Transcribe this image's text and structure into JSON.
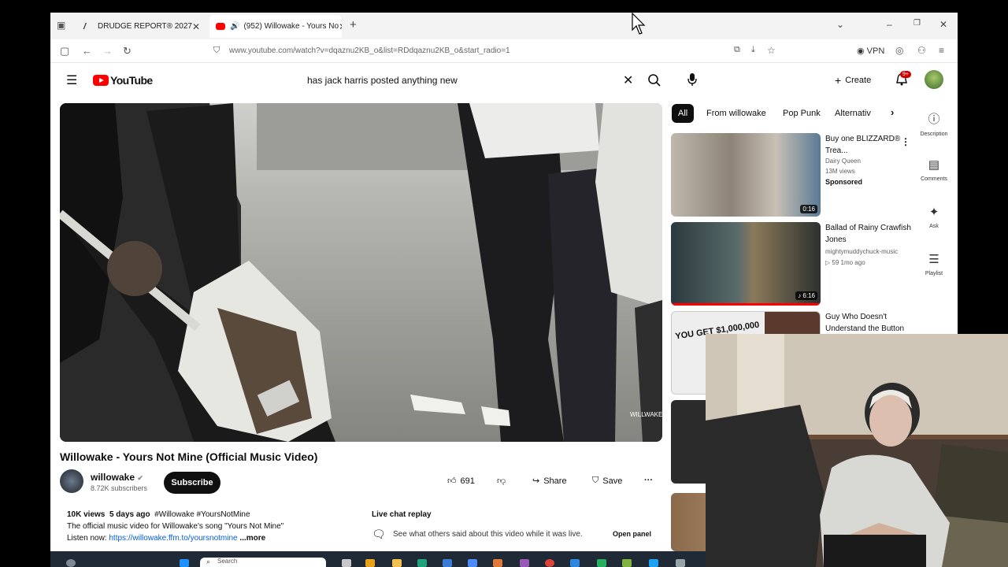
{
  "browser": {
    "tabs": [
      {
        "label": "DRUDGE REPORT® 2027"
      },
      {
        "label": "(952) Willowake - Yours No"
      }
    ],
    "url": "www.youtube.com/watch?v=dqaznu2KB_o&list=RDdqaznu2KB_o&start_radio=1",
    "vpn_label": "VPN"
  },
  "youtube": {
    "logo_text": "YouTube",
    "search_query": "has jack harris posted anything new",
    "create_label": "Create",
    "notif_count": "9+"
  },
  "video": {
    "title": "Willowake - Yours Not Mine (Official Music Video)",
    "channel": "willowake",
    "subscribers": "8.72K subscribers",
    "subscribe_label": "Subscribe",
    "likes": "691",
    "share_label": "Share",
    "save_label": "Save",
    "views": "10K views",
    "date": "5 days ago",
    "hashtags": "#Willowake #YoursNotMine",
    "description": "The official music video for Willowake's song \"Yours Not Mine\"",
    "listen_prefix": "Listen now:",
    "listen_link": "https://willowake.ffm.to/yoursnotmine",
    "more_label": "...more",
    "watermark": "WILLWAKE"
  },
  "chat": {
    "title": "Live chat replay",
    "text": "See what others said about this video while it was live.",
    "open_label": "Open panel"
  },
  "chips": [
    "All",
    "From willowake",
    "Pop Punk",
    "Alternativ"
  ],
  "recommended": [
    {
      "title": "Buy one BLIZZARD® Trea...",
      "channel": "Dairy Queen",
      "meta": "13M views",
      "badge": "Sponsored",
      "duration": "0:16"
    },
    {
      "title": "Ballad of Rainy Crawfish Jones",
      "channel": "mightymuddychuck-music",
      "meta": "59  1mo ago",
      "duration": "6:16"
    },
    {
      "title": "Guy Who Doesn't Understand the Button",
      "thumb_text": "YOU GET $1,000,000"
    }
  ],
  "side_panel": [
    {
      "label": "Description",
      "icon": "info-icon"
    },
    {
      "label": "Comments",
      "icon": "comment-icon"
    },
    {
      "label": "Ask",
      "icon": "sparkle-icon"
    },
    {
      "label": "Playlist",
      "icon": "playlist-icon"
    }
  ],
  "taskbar": {
    "search_placeholder": "Search"
  }
}
